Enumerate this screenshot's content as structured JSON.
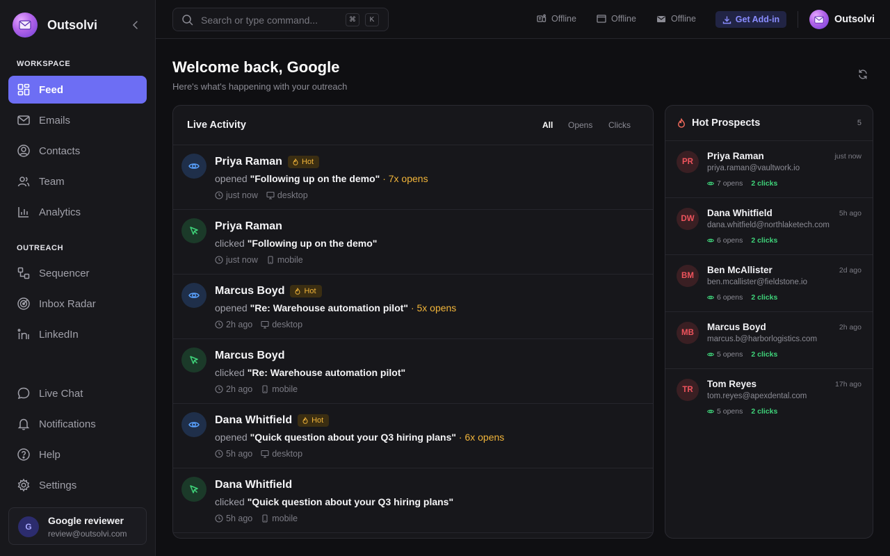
{
  "brand": {
    "name": "Outsolvi"
  },
  "sidebar": {
    "workspace_label": "WORKSPACE",
    "outreach_label": "OUTREACH",
    "workspace_items": [
      {
        "label": "Feed",
        "icon": "grid-icon",
        "active": true
      },
      {
        "label": "Emails",
        "icon": "mail-icon"
      },
      {
        "label": "Contacts",
        "icon": "contact-icon"
      },
      {
        "label": "Team",
        "icon": "team-icon"
      },
      {
        "label": "Analytics",
        "icon": "bar-chart-icon"
      }
    ],
    "outreach_items": [
      {
        "label": "Sequencer",
        "icon": "sequencer-icon"
      },
      {
        "label": "Inbox Radar",
        "icon": "radar-icon"
      },
      {
        "label": "LinkedIn",
        "icon": "linkedin-icon"
      }
    ],
    "bottom_items": [
      {
        "label": "Live Chat",
        "icon": "chat-icon"
      },
      {
        "label": "Notifications",
        "icon": "bell-icon"
      },
      {
        "label": "Help",
        "icon": "help-icon"
      },
      {
        "label": "Settings",
        "icon": "gear-icon"
      }
    ],
    "user": {
      "initial": "G",
      "name": "Google reviewer",
      "email": "review@outsolvi.com"
    }
  },
  "topbar": {
    "search_placeholder": "Search or type command...",
    "shortcut_keys": [
      "⌘",
      "K"
    ],
    "statuses": [
      {
        "icon": "teams-icon",
        "label": "Offline"
      },
      {
        "icon": "window-icon",
        "label": "Offline"
      },
      {
        "icon": "mail-icon",
        "label": "Offline"
      }
    ],
    "addin_label": "Get Add-in",
    "profile_name": "Outsolvi"
  },
  "header": {
    "title": "Welcome back, Google",
    "subtitle": "Here's what's happening with your outreach"
  },
  "activity": {
    "title": "Live Activity",
    "filters": [
      "All",
      "Opens",
      "Clicks"
    ],
    "active_filter": "All",
    "hot_label": "Hot",
    "items": [
      {
        "type": "open",
        "name": "Priya Raman",
        "hot": true,
        "verb": "opened",
        "subject": "\"Following up on the demo\"",
        "opens": "· 7x opens",
        "time": "just now",
        "device": "desktop"
      },
      {
        "type": "click",
        "name": "Priya Raman",
        "hot": false,
        "verb": "clicked",
        "subject": "\"Following up on the demo\"",
        "opens": "",
        "time": "just now",
        "device": "mobile"
      },
      {
        "type": "open",
        "name": "Marcus Boyd",
        "hot": true,
        "verb": "opened",
        "subject": "\"Re: Warehouse automation pilot\"",
        "opens": "· 5x opens",
        "time": "2h ago",
        "device": "desktop"
      },
      {
        "type": "click",
        "name": "Marcus Boyd",
        "hot": false,
        "verb": "clicked",
        "subject": "\"Re: Warehouse automation pilot\"",
        "opens": "",
        "time": "2h ago",
        "device": "mobile"
      },
      {
        "type": "open",
        "name": "Dana Whitfield",
        "hot": true,
        "verb": "opened",
        "subject": "\"Quick question about your Q3 hiring plans\"",
        "opens": "· 6x opens",
        "time": "5h ago",
        "device": "desktop"
      },
      {
        "type": "click",
        "name": "Dana Whitfield",
        "hot": false,
        "verb": "clicked",
        "subject": "\"Quick question about your Q3 hiring plans\"",
        "opens": "",
        "time": "5h ago",
        "device": "mobile"
      }
    ]
  },
  "prospects": {
    "title": "Hot Prospects",
    "count": "5",
    "items": [
      {
        "initials": "PR",
        "name": "Priya Raman",
        "email": "priya.raman@vaultwork.io",
        "time": "just now",
        "opens": "7 opens",
        "clicks": "2 clicks"
      },
      {
        "initials": "DW",
        "name": "Dana Whitfield",
        "email": "dana.whitfield@northlaketech.com",
        "time": "5h ago",
        "opens": "6 opens",
        "clicks": "2 clicks"
      },
      {
        "initials": "BM",
        "name": "Ben McAllister",
        "email": "ben.mcallister@fieldstone.io",
        "time": "2d ago",
        "opens": "6 opens",
        "clicks": "2 clicks"
      },
      {
        "initials": "MB",
        "name": "Marcus Boyd",
        "email": "marcus.b@harborlogistics.com",
        "time": "2h ago",
        "opens": "5 opens",
        "clicks": "2 clicks"
      },
      {
        "initials": "TR",
        "name": "Tom Reyes",
        "email": "tom.reyes@apexdental.com",
        "time": "17h ago",
        "opens": "5 opens",
        "clicks": "2 clicks"
      }
    ]
  },
  "colors": {
    "accent": "#6d6ef4",
    "hot": "#f2b53a",
    "click_green": "#3fd47a",
    "open_blue": "#5aa2ff",
    "prospect_red": "#f0545d"
  }
}
